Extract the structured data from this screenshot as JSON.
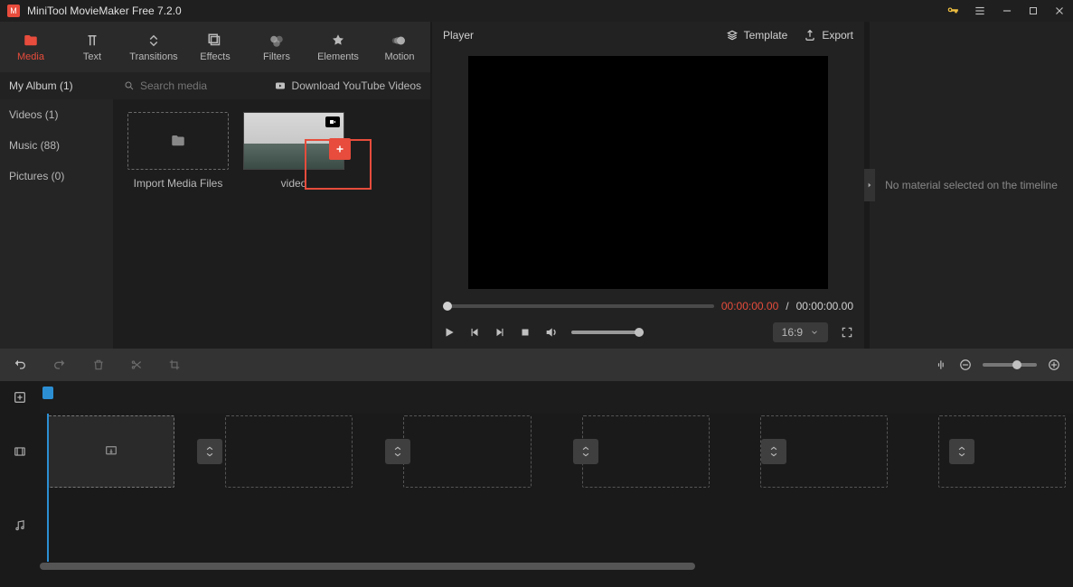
{
  "title": "MiniTool MovieMaker Free 7.2.0",
  "tabs": [
    {
      "id": "media",
      "label": "Media"
    },
    {
      "id": "text",
      "label": "Text"
    },
    {
      "id": "transitions",
      "label": "Transitions"
    },
    {
      "id": "effects",
      "label": "Effects"
    },
    {
      "id": "filters",
      "label": "Filters"
    },
    {
      "id": "elements",
      "label": "Elements"
    },
    {
      "id": "motion",
      "label": "Motion"
    }
  ],
  "active_tab": "media",
  "album": {
    "label": "My Album (1)"
  },
  "search": {
    "placeholder": "Search media"
  },
  "download_yt": "Download YouTube Videos",
  "sidebar": [
    {
      "label": "Videos (1)"
    },
    {
      "label": "Music (88)"
    },
    {
      "label": "Pictures (0)"
    }
  ],
  "import_label": "Import Media Files",
  "clip": {
    "label": "video"
  },
  "player": {
    "title": "Player",
    "template": "Template",
    "export": "Export",
    "time_current": "00:00:00.00",
    "time_sep": "/",
    "time_total": "00:00:00.00",
    "ratio": "16:9"
  },
  "right_panel": "No material selected on the timeline",
  "timeline": {
    "slot_count": 6
  }
}
